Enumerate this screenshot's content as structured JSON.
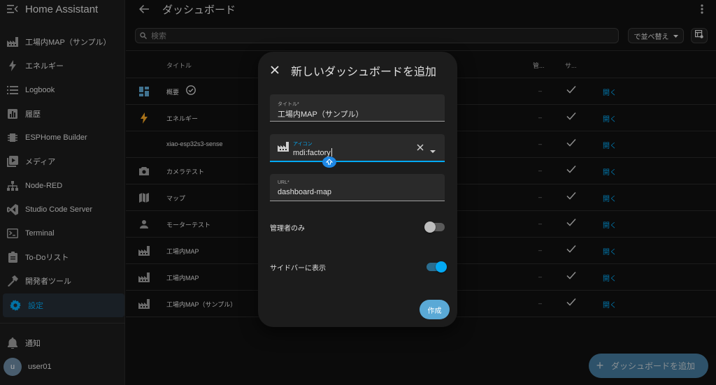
{
  "app": {
    "title": "Home Assistant"
  },
  "sidebar": {
    "items": [
      {
        "label": "工場内MAP（サンプル）",
        "icon": "factory-icon"
      },
      {
        "label": "エネルギー",
        "icon": "lightning-icon"
      },
      {
        "label": "Logbook",
        "icon": "list-icon"
      },
      {
        "label": "履歴",
        "icon": "chart-icon"
      },
      {
        "label": "ESPHome Builder",
        "icon": "chip-icon"
      },
      {
        "label": "メディア",
        "icon": "play-box-icon"
      },
      {
        "label": "Node-RED",
        "icon": "sitemap-icon"
      },
      {
        "label": "Studio Code Server",
        "icon": "vscode-icon"
      },
      {
        "label": "Terminal",
        "icon": "console-icon"
      },
      {
        "label": "To-Doリスト",
        "icon": "clipboard-icon"
      },
      {
        "label": "開発者ツール",
        "icon": "hammer-icon"
      },
      {
        "label": "設定",
        "icon": "gear-icon"
      }
    ],
    "notifications_label": "通知",
    "user": {
      "initial": "u",
      "name": "user01"
    }
  },
  "header": {
    "title": "ダッシュボード"
  },
  "search": {
    "placeholder": "検索"
  },
  "sort": {
    "label": "で並べ替え"
  },
  "table": {
    "columns": {
      "title": "タイトル",
      "admin": "管...",
      "sidebar": "サ..."
    },
    "open_label": "開く",
    "rows": [
      {
        "icon": "view-dashboard-icon",
        "name": "概要",
        "admin": "–",
        "sidebar": "✓",
        "default_badge": true
      },
      {
        "icon": "lightning-icon",
        "name": "エネルギー",
        "admin": "–",
        "sidebar": "✓"
      },
      {
        "icon": "",
        "name": "xiao-esp32s3-sense",
        "admin": "–",
        "sidebar": "✓"
      },
      {
        "icon": "camera-icon",
        "name": "カメラテスト",
        "admin": "–",
        "sidebar": "✓"
      },
      {
        "icon": "map-icon",
        "name": "マップ",
        "admin": "–",
        "sidebar": "✓"
      },
      {
        "icon": "person-icon",
        "name": "モーターテスト",
        "admin": "–",
        "sidebar": "✓"
      },
      {
        "icon": "factory-icon",
        "name": "工場内MAP",
        "admin": "–",
        "sidebar": "✓"
      },
      {
        "icon": "factory-icon",
        "name": "工場内MAP",
        "admin": "–",
        "sidebar": "✓"
      },
      {
        "icon": "factory-icon",
        "name": "工場内MAP（サンプル）",
        "admin": "–",
        "sidebar": "✓"
      }
    ]
  },
  "dialog": {
    "title": "新しいダッシュボードを追加",
    "title_field": {
      "label": "タイトル*",
      "value": "工場内MAP（サンプル）"
    },
    "icon_field": {
      "label": "アイコン",
      "value": "mdi:factory"
    },
    "url_field": {
      "label": "URL*",
      "value": "dashboard-map"
    },
    "admin_only": {
      "label": "管理者のみ",
      "checked": false
    },
    "show_in_sidebar": {
      "label": "サイドバーに表示",
      "checked": true
    },
    "create_label": "作成"
  },
  "fab": {
    "label": "ダッシュボードを追加"
  },
  "colors": {
    "accent": "#03a9f4",
    "background": "#111111",
    "surface": "#1c1c1c"
  }
}
